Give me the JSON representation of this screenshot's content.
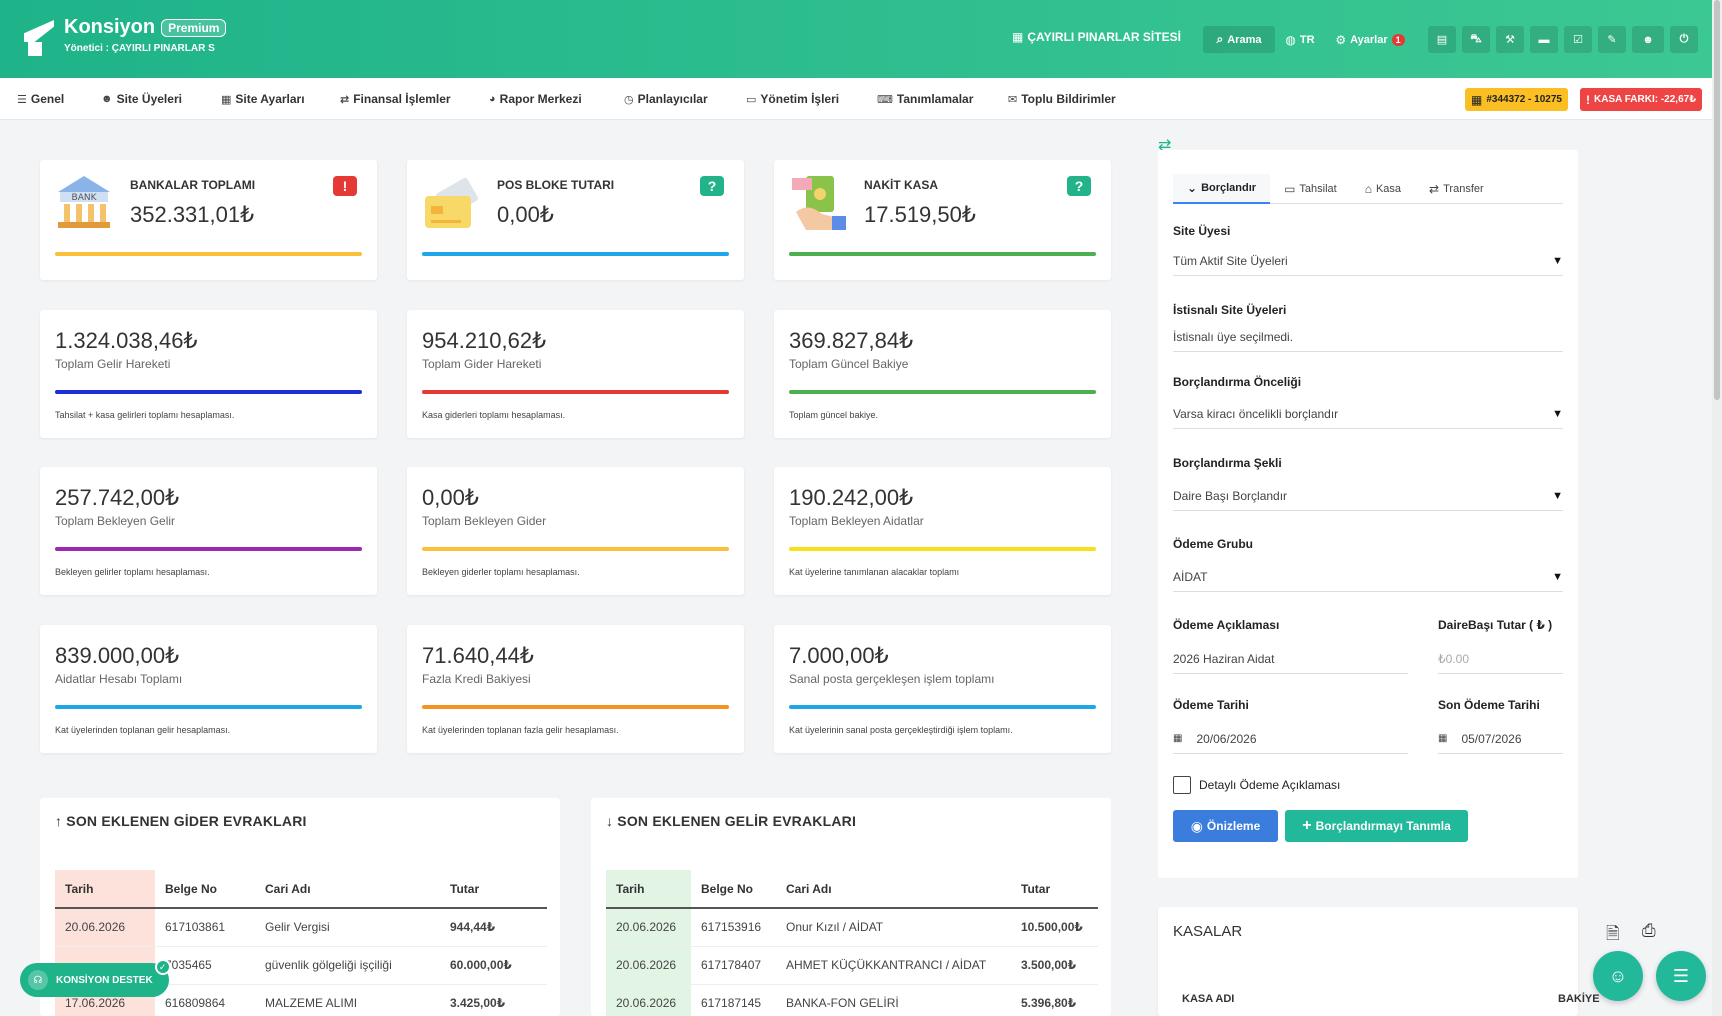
{
  "header": {
    "brand": "Konsiyon",
    "premium": "Premium",
    "manager": "Yönetici : ÇAYIRLI PINARLAR S",
    "site_name": "ÇAYIRLI PINARLAR SİTESİ",
    "search": "Arama",
    "lang": "TR",
    "settings": "Ayarlar",
    "settings_badge": "1"
  },
  "nav": {
    "items": [
      "Genel",
      "Site Üyeleri",
      "Site Ayarları",
      "Finansal İşlemler",
      "Rapor Merkezi",
      "Planlayıcılar",
      "Yönetim İşleri",
      "Tanımlamalar",
      "Toplu Bildirimler"
    ],
    "account_tag": "#344372 - 10275",
    "kasa_tag": "KASA FARKI: -22,67₺"
  },
  "summary": {
    "banks": {
      "title": "BANKALAR TOPLAMI",
      "value": "352.331,01₺",
      "bank_label": "BANK"
    },
    "pos": {
      "title": "POS BLOKE TUTARI",
      "value": "0,00₺"
    },
    "cash": {
      "title": "NAKİT KASA",
      "value": "17.519,50₺"
    }
  },
  "stats": [
    {
      "value": "1.324.038,46₺",
      "label": "Toplam Gelir Hareketi",
      "foot": "Tahsilat + kasa gelirleri toplamı hesaplaması.",
      "color": "#1a2fd6"
    },
    {
      "value": "954.210,62₺",
      "label": "Toplam Gider Hareketi",
      "foot": "Kasa giderleri toplamı hesaplaması.",
      "color": "#e53935"
    },
    {
      "value": "369.827,84₺",
      "label": "Toplam Güncel Bakiye",
      "foot": "Toplam güncel bakiye.",
      "color": "#4caf50"
    },
    {
      "value": "257.742,00₺",
      "label": "Toplam Bekleyen Gelir",
      "foot": "Bekleyen gelirler toplamı hesaplaması.",
      "color": "#9c27b0"
    },
    {
      "value": "0,00₺",
      "label": "Toplam Bekleyen Gider",
      "foot": "Bekleyen giderler toplamı hesaplaması.",
      "color": "#fbbf3c"
    },
    {
      "value": "190.242,00₺",
      "label": "Toplam Bekleyen Aidatlar",
      "foot": "Kat üyelerine tanımlanan alacaklar toplamı",
      "color": "#f7e017"
    },
    {
      "value": "839.000,00₺",
      "label": "Aidatlar Hesabı Toplamı",
      "foot": "Kat üyelerinden toplanan gelir hesaplaması.",
      "color": "#1ea7e8"
    },
    {
      "value": "71.640,44₺",
      "label": "Fazla Kredi Bakiyesi",
      "foot": "Kat üyelerinden toplanan fazla gelir hesaplaması.",
      "color": "#f59321"
    },
    {
      "value": "7.000,00₺",
      "label": "Sanal posta gerçekleşen işlem toplamı",
      "foot": "Kat üyelerinin sanal posta gerçekleştirdiği işlem toplamı.",
      "color": "#1ea7e8"
    }
  ],
  "expense": {
    "title": "SON EKLENEN GİDER EVRAKLARI",
    "headers": [
      "Tarih",
      "Belge No",
      "Cari Adı",
      "Tutar"
    ],
    "rows": [
      [
        "20.06.2026",
        "617103861",
        "Gelir Vergisi",
        "944,44₺"
      ],
      [
        "",
        "7035465",
        "güvenlik gölgeliği işçiliği",
        "60.000,00₺"
      ],
      [
        "17.06.2026",
        "616809864",
        "MALZEME ALIMI",
        "3.425,00₺"
      ]
    ]
  },
  "income": {
    "title": "SON EKLENEN GELİR EVRAKLARI",
    "headers": [
      "Tarih",
      "Belge No",
      "Cari Adı",
      "Tutar"
    ],
    "rows": [
      [
        "20.06.2026",
        "617153916",
        "Onur Kızıl / AİDAT",
        "10.500,00₺"
      ],
      [
        "20.06.2026",
        "617178407",
        "AHMET KÜÇÜKKANTRANCI / AİDAT",
        "3.500,00₺"
      ],
      [
        "20.06.2026",
        "617187145",
        "BANKA-FON GELİRİ",
        "5.396,80₺"
      ]
    ]
  },
  "form": {
    "tabs": [
      "Borçlandır",
      "Tahsilat",
      "Kasa",
      "Transfer"
    ],
    "site_member_label": "Site Üyesi",
    "site_member_value": "Tüm Aktif Site Üyeleri",
    "exempt_label": "İstisnalı Site Üyeleri",
    "exempt_value": "İstisnalı üye seçilmedi.",
    "priority_label": "Borçlandırma Önceliği",
    "priority_value": "Varsa kiracı öncelikli borçlandır",
    "method_label": "Borçlandırma Şekli",
    "method_value": "Daire Başı Borçlandır",
    "group_label": "Ödeme Grubu",
    "group_value": "AİDAT",
    "desc_label": "Ödeme Açıklaması",
    "desc_value": "2026 Haziran Aidat",
    "amount_label": "DaireBaşı Tutar ( ₺ )",
    "amount_placeholder": "₺0.00",
    "date_label": "Ödeme Tarihi",
    "date_value": "20/06/2026",
    "due_label": "Son Ödeme Tarihi",
    "due_value": "05/07/2026",
    "detail_checkbox": "Detaylı Ödeme Açıklaması",
    "preview_btn": "Önizleme",
    "define_btn": "Borçlandırmayı Tanımla"
  },
  "kasalar": {
    "title": "KASALAR",
    "col_name": "KASA ADI",
    "col_balance": "BAKİYE"
  },
  "support": "KONSİYON DESTEK"
}
